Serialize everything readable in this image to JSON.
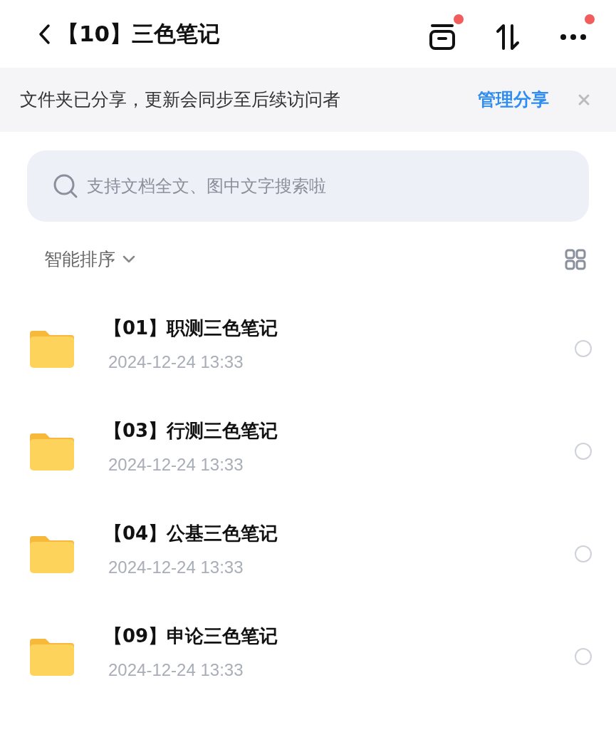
{
  "header": {
    "title": "【10】三色笔记",
    "actions": [
      {
        "kind": "box",
        "badge": true
      },
      {
        "kind": "sort",
        "badge": false
      },
      {
        "kind": "more",
        "badge": true
      }
    ]
  },
  "banner": {
    "text": "文件夹已分享，更新会同步至后续访问者",
    "link": "管理分享"
  },
  "search": {
    "placeholder": "支持文档全文、图中文字搜索啦"
  },
  "sort": {
    "label": "智能排序"
  },
  "files": [
    {
      "name": "【01】职测三色笔记",
      "date": "2024-12-24 13:33",
      "selected": false
    },
    {
      "name": "【03】行测三色笔记",
      "date": "2024-12-24 13:33",
      "selected": false
    },
    {
      "name": "【04】公基三色笔记",
      "date": "2024-12-24 13:33",
      "selected": false
    },
    {
      "name": "【09】申论三色笔记",
      "date": "2024-12-24 13:33",
      "selected": false
    }
  ]
}
